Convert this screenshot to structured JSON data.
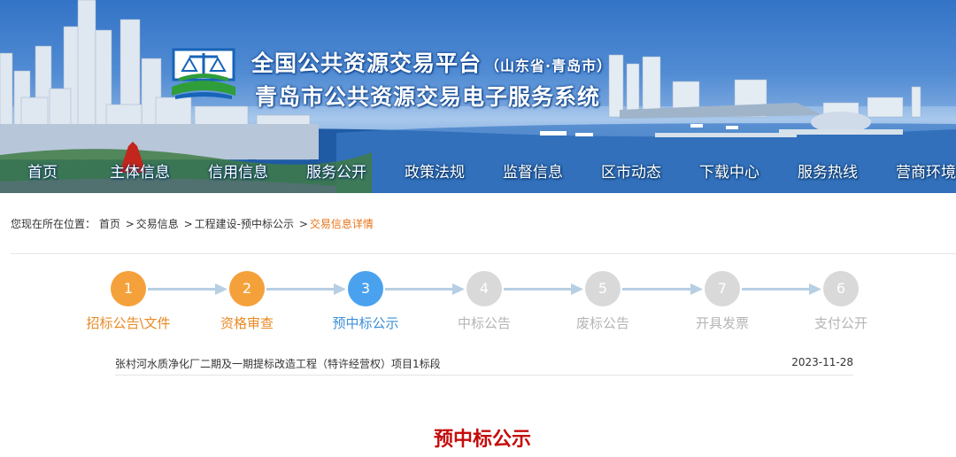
{
  "header": {
    "title_main": "全国公共资源交易平台",
    "title_region": "（山东省·青岛市）",
    "title_system": "青岛市公共资源交易电子服务系统"
  },
  "nav": [
    "首页",
    "主体信息",
    "信用信息",
    "服务公开",
    "政策法规",
    "监督信息",
    "区市动态",
    "下载中心",
    "服务热线",
    "营商环境"
  ],
  "breadcrumb": {
    "prefix": "您现在所在位置：",
    "items": [
      "首页",
      "交易信息",
      "工程建设-预中标公示"
    ],
    "current": "交易信息详情",
    "separator": ">"
  },
  "steps": [
    {
      "number": "1",
      "label": "招标公告\\文件",
      "status": "done"
    },
    {
      "number": "2",
      "label": "资格审查",
      "status": "done"
    },
    {
      "number": "3",
      "label": "预中标公示",
      "status": "active"
    },
    {
      "number": "4",
      "label": "中标公告",
      "status": "pending"
    },
    {
      "number": "5",
      "label": "废标公告",
      "status": "pending"
    },
    {
      "number": "7",
      "label": "开具发票",
      "status": "pending"
    },
    {
      "number": "6",
      "label": "支付公开",
      "status": "pending"
    }
  ],
  "colors": {
    "done": "#f5a13b",
    "active": "#4aa2ef",
    "pending": "#d9d9d9",
    "accent": "#e8741a",
    "title_red": "#c40c0c"
  },
  "project": {
    "title": "张村河水质净化厂二期及一期提标改造工程（特许经营权）项目1标段",
    "date": "2023-11-28"
  },
  "announcement_title": "预中标公示"
}
